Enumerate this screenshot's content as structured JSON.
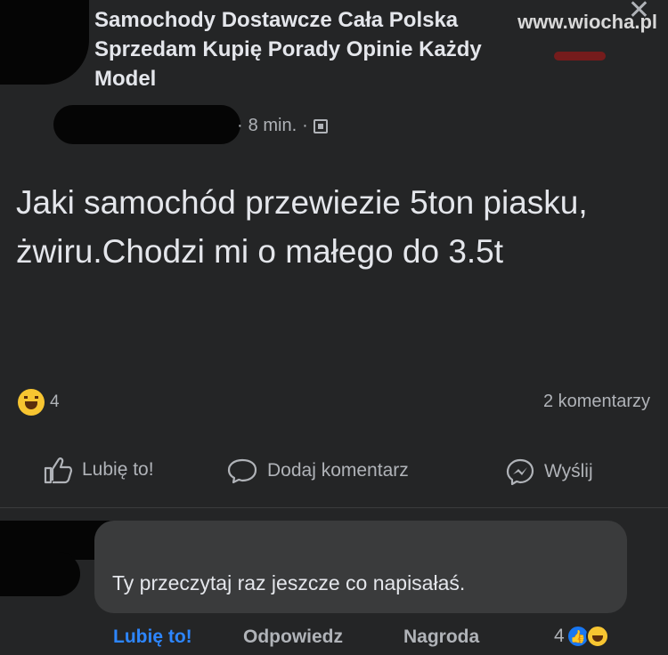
{
  "post": {
    "group_name": "Samochody Dostawcze Cała Polska Sprzedam Kupię Porady Opinie Każdy Model",
    "time": "8 min.",
    "separator": "·",
    "text": "Jaki samochód przewiezie 5ton piasku, żwiru.Chodzi mi o małego do 3.5t",
    "reaction_count": "4",
    "comments_count": "2 komentarzy"
  },
  "watermark": "www.wiocha.pl",
  "close_icon": "✕",
  "actions": {
    "like_label": "Lubię to!",
    "comment_label": "Dodaj komentarz",
    "send_label": "Wyślij"
  },
  "comment": {
    "text": "Ty przeczytaj raz jeszcze co napisałaś.",
    "like_label": "Lubię to!",
    "reply_label": "Odpowiedz",
    "award_label": "Nagroda",
    "reaction_count": "4"
  },
  "icons": {
    "reaction": "haha-icon",
    "like": "thumbs-up-icon",
    "comment": "comment-bubble-icon",
    "send": "messenger-icon",
    "privacy": "group-privacy-icon"
  },
  "colors": {
    "background": "#242526",
    "text": "#e4e6eb",
    "muted": "#b0b3b8",
    "accent": "#2d86ff"
  }
}
